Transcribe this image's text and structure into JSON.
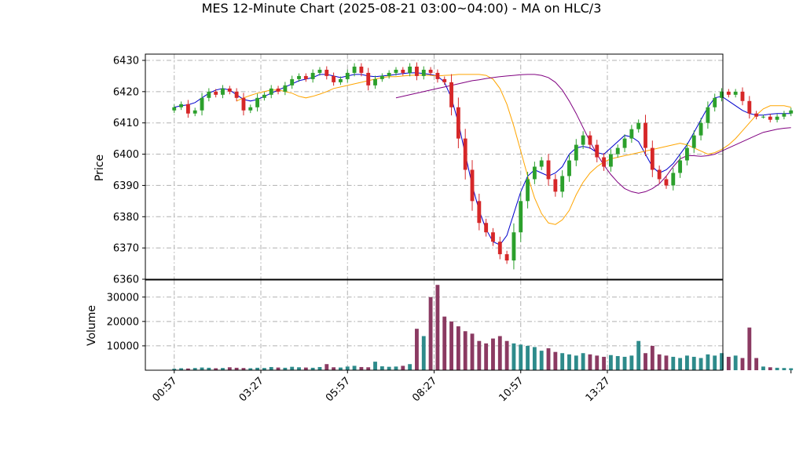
{
  "chart_data": {
    "type": "candlestick",
    "title": "MES 12-Minute Chart (2025-08-21 03:00~04:00) - MA on HLC/3",
    "price_panel": {
      "ylabel": "Price",
      "ylim": [
        6360,
        6432
      ],
      "yticks": [
        "6360",
        "6370",
        "6380",
        "6390",
        "6400",
        "6410",
        "6420",
        "6430"
      ],
      "grid": true,
      "up_color": "#2ca02c",
      "down_color": "#d62728"
    },
    "volume_panel": {
      "ylabel": "Volume",
      "ylim": [
        0,
        37000
      ],
      "yticks": [
        "10000",
        "20000",
        "30000"
      ],
      "grid": true,
      "color": "#2e8b8b"
    },
    "x_ticks": [
      "00:57",
      "03:27",
      "05:57",
      "08:27",
      "10:57",
      "13:27"
    ],
    "x_range": [
      "00:07",
      "16:47"
    ],
    "bars": {
      "start": "00:57",
      "interval_minutes": 12,
      "close": [
        6415,
        6416,
        6413,
        6414,
        6418,
        6420,
        6419,
        6421,
        6420,
        6418,
        6414,
        6415,
        6418,
        6419,
        6421,
        6420,
        6422,
        6424,
        6425,
        6424,
        6426,
        6427,
        6425,
        6423,
        6424,
        6426,
        6428,
        6426,
        6422,
        6424,
        6425,
        6426,
        6427,
        6426,
        6428,
        6425,
        6427,
        6426,
        6424,
        6423,
        6415,
        6405,
        6395,
        6385,
        6378,
        6375,
        6372,
        6368,
        6366,
        6375,
        6385,
        6392,
        6396,
        6398,
        6392,
        6388,
        6393,
        6398,
        6403,
        6406,
        6403,
        6399,
        6396,
        6400,
        6402,
        6405,
        6408,
        6410,
        6402,
        6395,
        6392,
        6390,
        6394,
        6398,
        6402,
        6406,
        6410,
        6415,
        6418,
        6420,
        6419,
        6420,
        6417,
        6413,
        6412,
        6412,
        6411,
        6412,
        6413,
        6414
      ],
      "volume": [
        600,
        800,
        700,
        900,
        1100,
        1000,
        800,
        900,
        1200,
        1000,
        900,
        800,
        1000,
        900,
        1300,
        1100,
        1000,
        1400,
        1200,
        1100,
        1000,
        1300,
        2500,
        1200,
        1100,
        1500,
        1800,
        1300,
        1200,
        3500,
        1600,
        1400,
        1500,
        1800,
        2500,
        17000,
        14000,
        30000,
        35000,
        22000,
        20000,
        18000,
        16000,
        15000,
        12000,
        11000,
        13000,
        14000,
        12000,
        11000,
        10500,
        10000,
        9500,
        8000,
        9000,
        7500,
        7000,
        6500,
        6000,
        7000,
        6500,
        6000,
        5500,
        6200,
        5800,
        5500,
        6000,
        12000,
        7000,
        10000,
        6500,
        6000,
        5500,
        5000,
        6000,
        5500,
        5000,
        6500,
        6000,
        7000,
        5500,
        6000,
        5000,
        17500,
        5000,
        1500,
        1200,
        1000,
        900,
        800
      ]
    },
    "moving_averages": [
      {
        "color": "#0000cc",
        "values": [
          6415,
          6415.5,
          6415.8,
          6416.5,
          6418,
          6419.5,
          6420.5,
          6421,
          6420.5,
          6419,
          6417.5,
          6417,
          6417.5,
          6418.5,
          6419.5,
          6420.5,
          6421.5,
          6422.5,
          6423.5,
          6424,
          6424.5,
          6425.5,
          6425.5,
          6425,
          6424.5,
          6425,
          6425.5,
          6425.5,
          6425,
          6424.8,
          6425,
          6425.2,
          6425.5,
          6425.8,
          6426,
          6426,
          6425.8,
          6425.5,
          6425,
          6423,
          6418,
          6410,
          6400,
          6390,
          6382,
          6376,
          6372,
          6371,
          6374,
          6381,
          6388,
          6393,
          6395,
          6394,
          6393,
          6394,
          6396,
          6400,
          6402,
          6402.5,
          6402,
          6400.5,
          6400,
          6402,
          6404,
          6406,
          6405.5,
          6404,
          6400,
          6396,
          6394,
          6395,
          6397,
          6400,
          6403,
          6407,
          6411,
          6415,
          6418,
          6418.5,
          6417,
          6415.5,
          6414,
          6413,
          6412.5,
          6412.5,
          6412.8,
          6413,
          6413,
          6413
        ]
      },
      {
        "color": "#ffa500",
        "values": [
          6417,
          6418,
          6418.8,
          6419.5,
          6420,
          6420.5,
          6420.5,
          6420,
          6419.5,
          6418.5,
          6418,
          6418.5,
          6419.2,
          6420,
          6421,
          6421.5,
          6422,
          6422.5,
          6423,
          6423.5,
          6424,
          6424.5,
          6424.8,
          6424.8,
          6425,
          6425.2,
          6425.3,
          6425.3,
          6425.2,
          6425,
          6425.2,
          6425.3,
          6425.5,
          6425.5,
          6425.5,
          6425.5,
          6425.2,
          6424,
          6421,
          6416,
          6409,
          6401,
          6393,
          6386,
          6381,
          6378,
          6377.5,
          6379,
          6382,
          6387,
          6391,
          6394,
          6396,
          6397.5,
          6398.5,
          6399,
          6399.5,
          6400,
          6400.5,
          6401,
          6401.5,
          6402,
          6402.5,
          6403,
          6403.5,
          6403,
          6402,
          6401,
          6400,
          6400.5,
          6401.5,
          6403,
          6405,
          6407.5,
          6410,
          6412.5,
          6414.5,
          6415.5,
          6415.5,
          6415.5,
          6415
        ]
      },
      {
        "color": "#800080",
        "values": [
          6418,
          6418.5,
          6419,
          6419.5,
          6420,
          6420.5,
          6421,
          6421.5,
          6422,
          6422.5,
          6423,
          6423.5,
          6423.8,
          6424.2,
          6424.5,
          6424.8,
          6425,
          6425.2,
          6425.4,
          6425.5,
          6425.5,
          6425.2,
          6424.5,
          6423,
          6420.5,
          6417,
          6413,
          6408.5,
          6404,
          6400,
          6396.5,
          6393.5,
          6391,
          6389,
          6388,
          6387.5,
          6388,
          6389,
          6390.5,
          6393,
          6396,
          6398.5,
          6399.5,
          6399.5,
          6399.3,
          6399.5,
          6400,
          6401,
          6402,
          6403,
          6404,
          6405,
          6406,
          6407,
          6407.5,
          6408,
          6408.3,
          6408.5
        ]
      }
    ]
  }
}
